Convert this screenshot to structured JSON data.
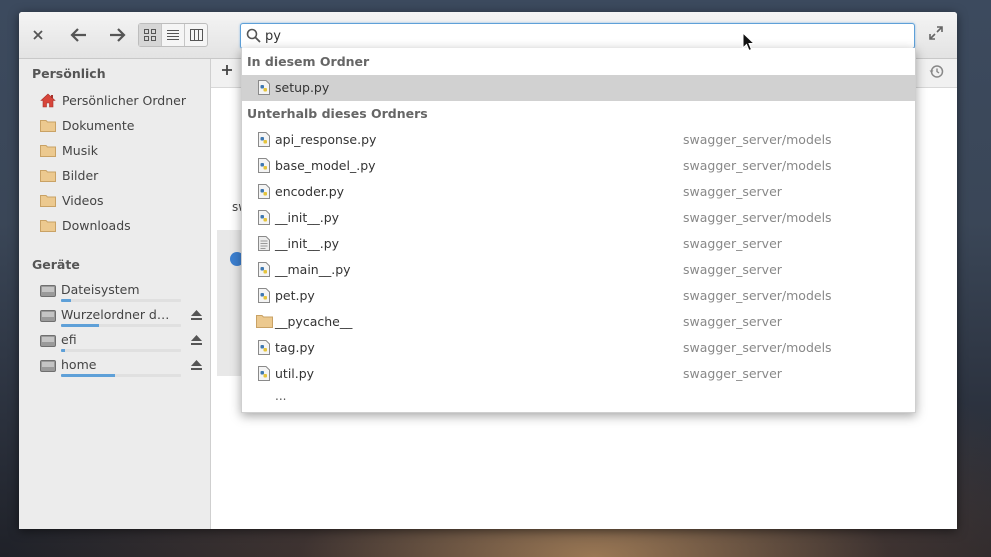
{
  "search": {
    "query": "py"
  },
  "sidebar": {
    "personal_heading": "Persönlich",
    "places": [
      {
        "label": "Persönlicher Ordner",
        "icon": "home-icon"
      },
      {
        "label": "Dokumente",
        "icon": "folder-icon"
      },
      {
        "label": "Musik",
        "icon": "folder-icon"
      },
      {
        "label": "Bilder",
        "icon": "folder-icon"
      },
      {
        "label": "Videos",
        "icon": "folder-icon"
      },
      {
        "label": "Downloads",
        "icon": "folder-icon"
      }
    ],
    "devices_heading": "Geräte",
    "devices": [
      {
        "label": "Dateisystem",
        "usage": 0.08,
        "ejectable": false
      },
      {
        "label": "Wurzelordner des ...",
        "usage": 0.32,
        "ejectable": true
      },
      {
        "label": "efi",
        "usage": 0.03,
        "ejectable": true
      },
      {
        "label": "home",
        "usage": 0.45,
        "ejectable": true
      }
    ]
  },
  "main": {
    "partial_label": "sw"
  },
  "popup": {
    "here_heading": "In diesem Ordner",
    "here_results": [
      {
        "name": "setup.py",
        "type": "python-file"
      }
    ],
    "below_heading": "Unterhalb dieses Ordners",
    "below_results": [
      {
        "name": "api_response.py",
        "path": "swagger_server/models",
        "type": "python-file"
      },
      {
        "name": "base_model_.py",
        "path": "swagger_server/models",
        "type": "python-file"
      },
      {
        "name": "encoder.py",
        "path": "swagger_server",
        "type": "python-file"
      },
      {
        "name": "__init__.py",
        "path": "swagger_server/models",
        "type": "python-file"
      },
      {
        "name": "__init__.py",
        "path": "swagger_server",
        "type": "text-file"
      },
      {
        "name": "__main__.py",
        "path": "swagger_server",
        "type": "python-file"
      },
      {
        "name": "pet.py",
        "path": "swagger_server/models",
        "type": "python-file"
      },
      {
        "name": "__pycache__",
        "path": "swagger_server",
        "type": "folder"
      },
      {
        "name": "tag.py",
        "path": "swagger_server/models",
        "type": "python-file"
      },
      {
        "name": "util.py",
        "path": "swagger_server",
        "type": "python-file"
      }
    ],
    "more": "..."
  },
  "colors": {
    "accent": "#5ea0d8",
    "selection": "#d1d1d1",
    "folder": "#e8c486"
  }
}
